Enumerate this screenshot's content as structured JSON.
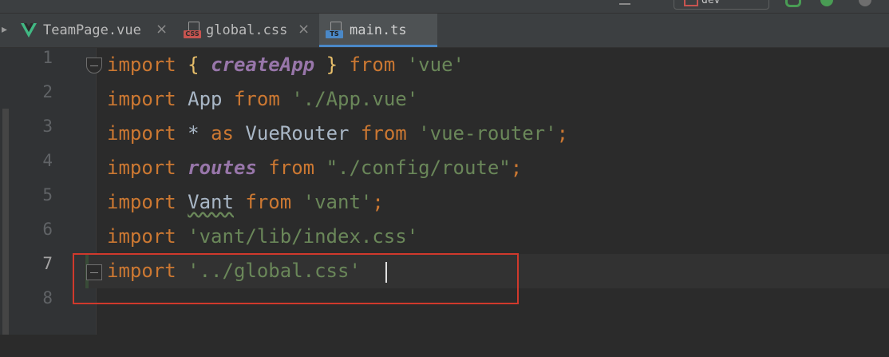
{
  "top_widget_text": "dev",
  "tab_scroll_glyph": "▸",
  "tabs": [
    {
      "label": "TeamPage.vue",
      "icon": "vue-icon",
      "active": false
    },
    {
      "label": "global.css",
      "icon": "css-file-icon",
      "icon_badge": "CSS",
      "active": false
    },
    {
      "label": "main.ts",
      "icon": "typescript-file-icon",
      "icon_badge": "TS",
      "active": true
    }
  ],
  "close_glyph": "×",
  "line_numbers": [
    "1",
    "2",
    "3",
    "4",
    "5",
    "6",
    "7",
    "8"
  ],
  "current_line": "7",
  "code": {
    "l1": {
      "kw1": "import",
      "b1": "{",
      "name": "createApp",
      "b2": "}",
      "kw2": "from",
      "str": "'vue'"
    },
    "l2": {
      "kw1": "import",
      "name": "App",
      "kw2": "from",
      "str": "'./App.vue'"
    },
    "l3": {
      "kw1": "import",
      "star": "*",
      "kw_as": "as",
      "name": "VueRouter",
      "kw2": "from",
      "str": "'vue-router'",
      "semi": ";"
    },
    "l4": {
      "kw1": "import",
      "name": "routes",
      "kw2": "from",
      "str": "\"./config/route\"",
      "semi": ";"
    },
    "l5": {
      "kw1": "import",
      "name": "Vant",
      "kw2": "from",
      "str": "'vant'",
      "semi": ";"
    },
    "l6": {
      "kw1": "import",
      "str": "'vant/lib/index.css'"
    },
    "l7": {
      "kw1": "import",
      "str": "'../global.css'"
    }
  },
  "colors": {
    "keyword": "#cc7832",
    "string": "#6a8759",
    "identifier": "#a9b7c6",
    "import_name": "#9876aa",
    "active_tab_underline": "#4a88c7",
    "annotation_box": "#d0392c"
  }
}
